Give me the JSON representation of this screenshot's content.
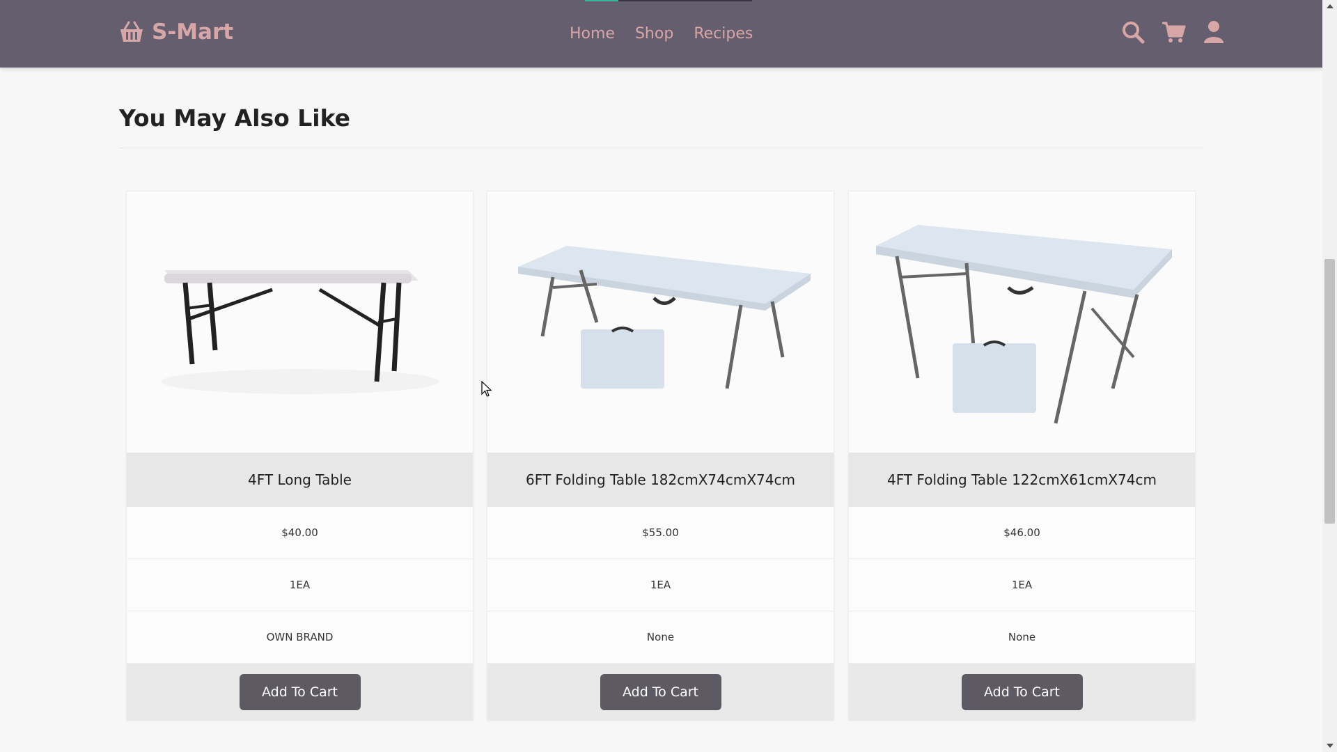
{
  "header": {
    "brand": "S-Mart",
    "brand_color": "#d7a7a7",
    "background_color": "#655e6e",
    "nav": [
      {
        "label": "Home"
      },
      {
        "label": "Shop"
      },
      {
        "label": "Recipes"
      }
    ],
    "icons": [
      "basket-icon",
      "search-icon",
      "cart-icon",
      "user-icon"
    ]
  },
  "section": {
    "title": "You May Also Like"
  },
  "products": [
    {
      "name": "4FT Long Table",
      "price": "$40.00",
      "unit": "1EA",
      "brand": "OWN BRAND",
      "button": "Add To Cart"
    },
    {
      "name": "6FT Folding Table 182cmX74cmX74cm",
      "price": "$55.00",
      "unit": "1EA",
      "brand": "None",
      "button": "Add To Cart"
    },
    {
      "name": "4FT Folding Table 122cmX61cmX74cm",
      "price": "$46.00",
      "unit": "1EA",
      "brand": "None",
      "button": "Add To Cart"
    }
  ],
  "colors": {
    "button": "#5e5a63",
    "title_row": "#e7e7e7",
    "page_background": "#f7f7f7"
  }
}
